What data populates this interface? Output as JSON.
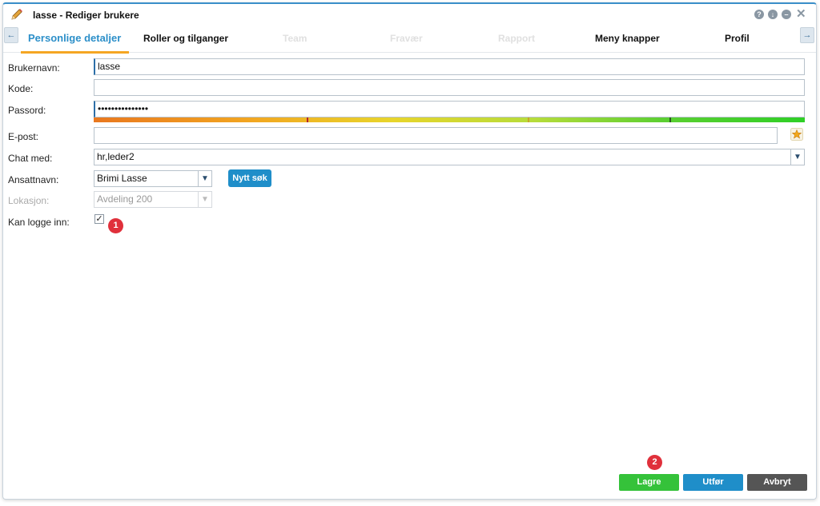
{
  "window": {
    "title": "lasse - Rediger brukere",
    "title_icon": "pencil-icon",
    "controls": [
      "help-icon",
      "down-icon",
      "minimize-icon",
      "close-icon"
    ]
  },
  "tabs": [
    {
      "label": "Personlige detaljer",
      "state": "active"
    },
    {
      "label": "Roller og tilganger",
      "state": "normal"
    },
    {
      "label": "Team",
      "state": "disabled"
    },
    {
      "label": "Fravær",
      "state": "disabled"
    },
    {
      "label": "Rapport",
      "state": "disabled"
    },
    {
      "label": "Meny knapper",
      "state": "normal"
    },
    {
      "label": "Profil",
      "state": "normal"
    }
  ],
  "tab_scroll": {
    "left": "←",
    "right": "→"
  },
  "form": {
    "username": {
      "label": "Brukernavn:",
      "value": "lasse"
    },
    "code": {
      "label": "Kode:",
      "value": ""
    },
    "password": {
      "label": "Passord:",
      "value": "•••••••••••••••"
    },
    "email": {
      "label": "E-post:",
      "value": ""
    },
    "chat": {
      "label": "Chat med:",
      "value": "hr,leder2"
    },
    "employee": {
      "label": "Ansattnavn:",
      "value": "Brimi Lasse"
    },
    "new_search_label": "Nytt søk",
    "location": {
      "label": "Lokasjon:",
      "value": "Avdeling 200"
    },
    "can_login": {
      "label": "Kan logge inn:",
      "checked": true,
      "mark": "✓"
    }
  },
  "badges": {
    "one": "1",
    "two": "2"
  },
  "buttons": {
    "save": "Lagre",
    "execute": "Utfør",
    "cancel": "Avbryt"
  },
  "colors": {
    "accent": "#2c8fc9",
    "tab_underline": "#f5a623",
    "save": "#35c23a",
    "execute": "#1f8ec9",
    "cancel": "#555555",
    "badge": "#e0303b"
  }
}
